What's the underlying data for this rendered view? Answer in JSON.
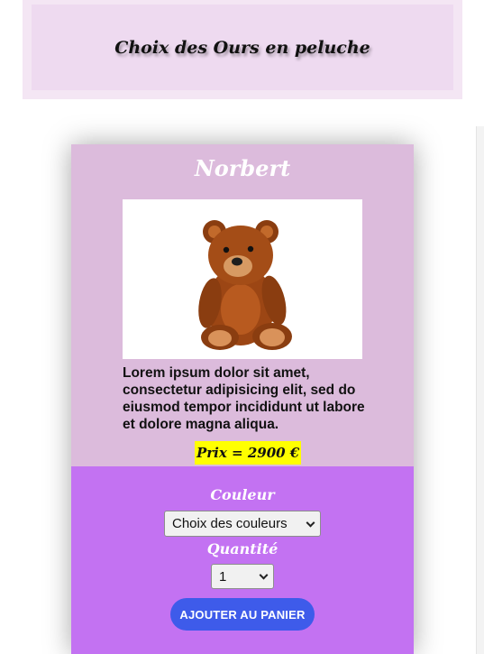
{
  "header": {
    "title": "Choix des Ours en peluche"
  },
  "product": {
    "name": "Norbert",
    "image_alt": "teddy-bear-photo",
    "description": "Lorem ipsum dolor sit amet, consectetur adipisicing elit, sed do eiusmod tempor incididunt ut labore et dolore magna aliqua.",
    "price": "Prix = 2900 €"
  },
  "options": {
    "color_label": "Couleur",
    "color_selected": "Choix des couleurs",
    "quantity_label": "Quantité",
    "quantity_selected": "1",
    "add_button_label": "AJOUTER AU PANIER"
  },
  "colors": {
    "header_bg": "#eedaf0",
    "card_top_bg": "#dcbbdc",
    "card_bottom_bg": "#c372f2",
    "price_highlight": "#ffff00",
    "button_bg": "#3e5bea"
  }
}
